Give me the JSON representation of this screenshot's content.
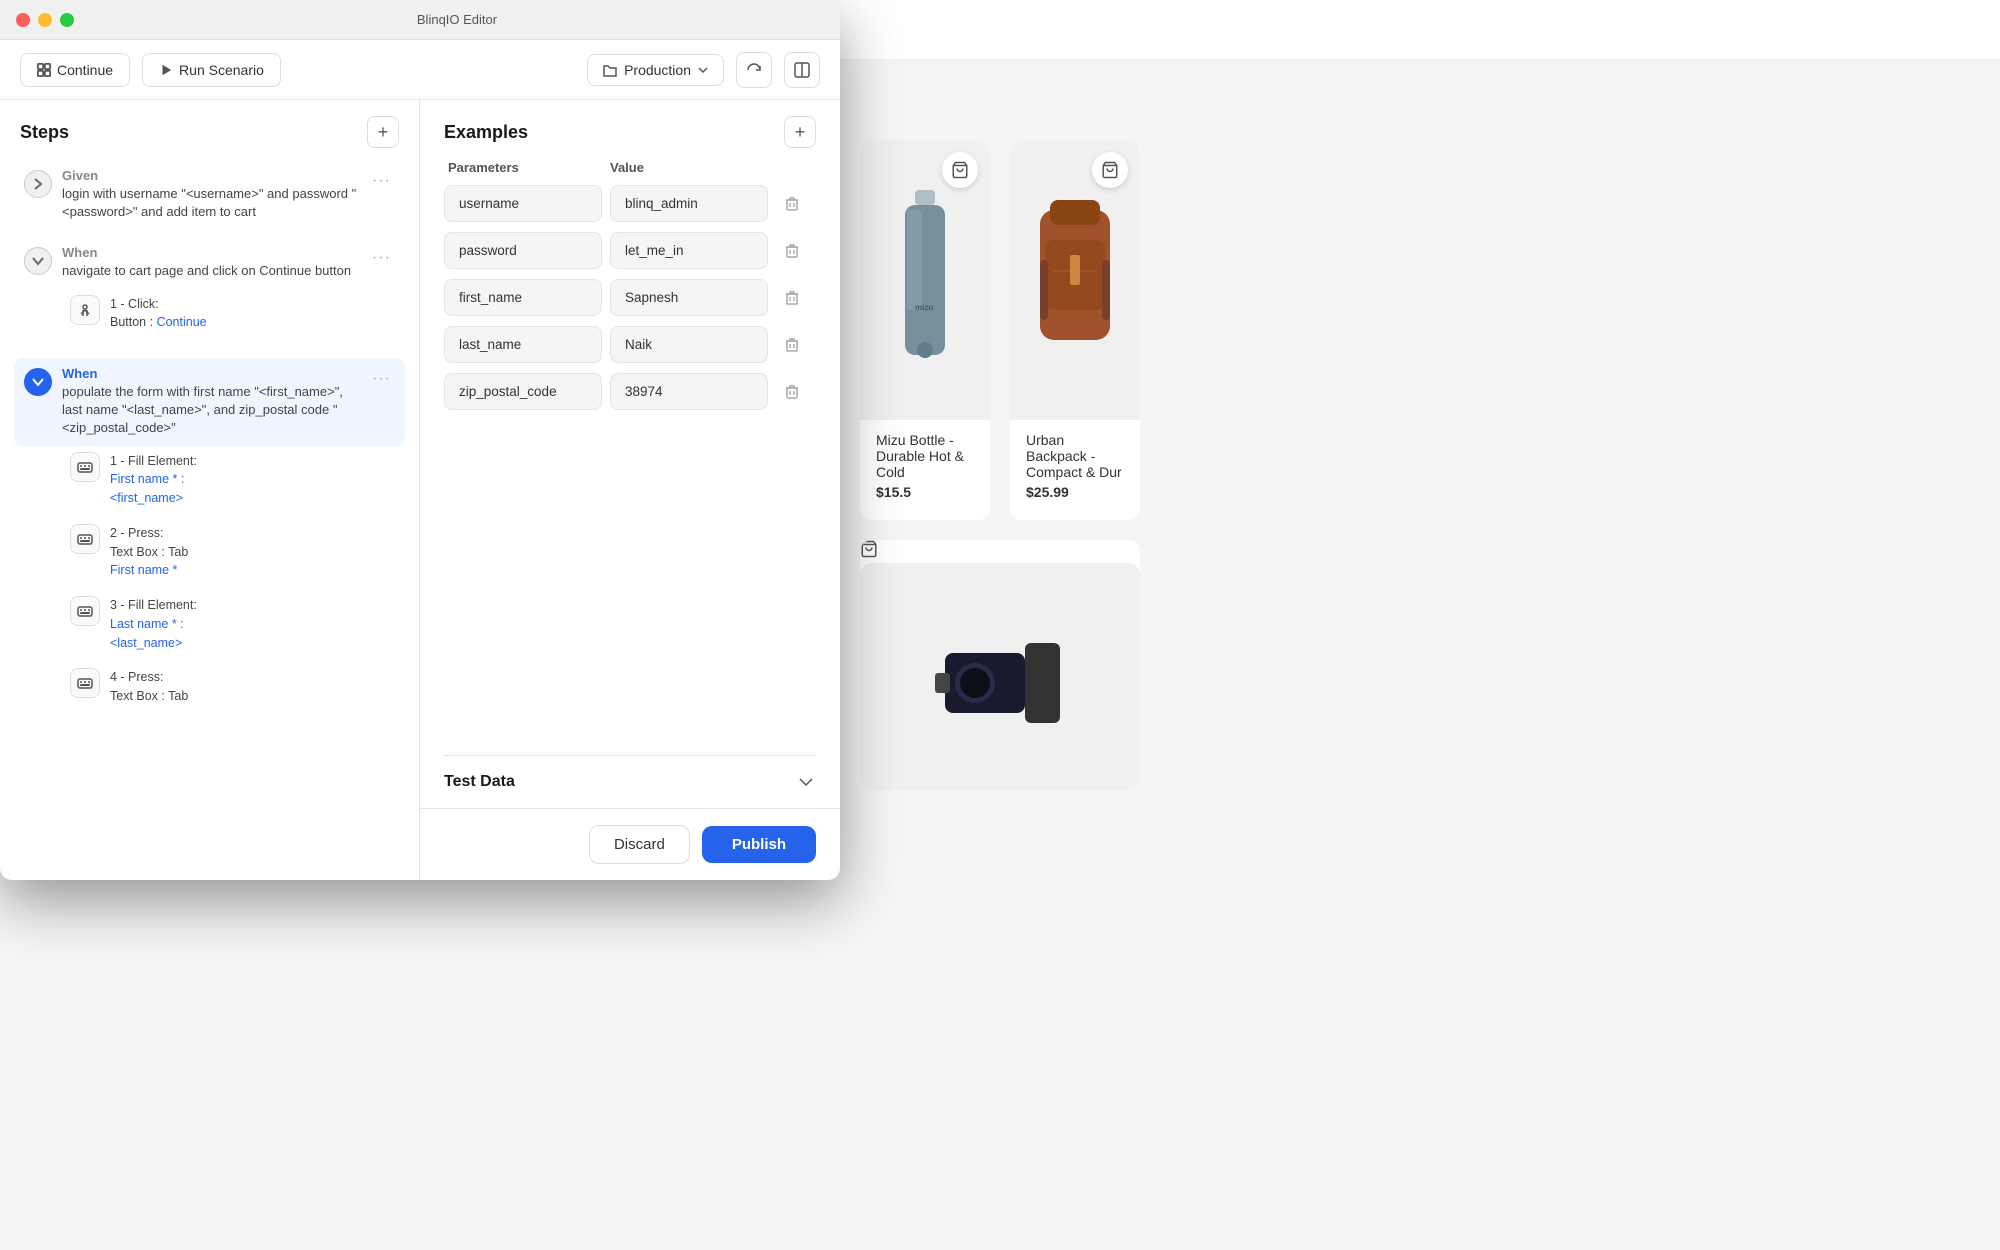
{
  "app": {
    "title": "BlinqIO Editor",
    "window_controls": {
      "red": "close",
      "yellow": "minimize",
      "green": "maximize"
    }
  },
  "toolbar": {
    "continue_label": "Continue",
    "run_scenario_label": "Run Scenario",
    "environment": "Production",
    "env_icon": "folder-icon",
    "refresh_icon": "refresh-icon",
    "layout_icon": "layout-icon"
  },
  "steps": {
    "title": "Steps",
    "add_button_label": "+",
    "items": [
      {
        "type": "Given",
        "description": "login with username \"<username>\" and password \"<password>\" and add item to cart",
        "expanded": false
      },
      {
        "type": "When",
        "description": "navigate to cart page and click on Continue button",
        "expanded": true,
        "sub_steps": [
          {
            "number": "1",
            "action": "Click:",
            "target": "Button : Continue",
            "target_link": "Continue"
          }
        ]
      },
      {
        "type": "When",
        "description": "populate the form with first name \"<first_name>\", last name \"<last_name>\", and zip_postal code \"<zip_postal_code>\"",
        "expanded": true,
        "active": true,
        "sub_steps": [
          {
            "number": "1",
            "action": "Fill Element:",
            "target": "First name * :",
            "target_link": "First name *",
            "variable": "<first_name>"
          },
          {
            "number": "2",
            "action": "Press:",
            "target": "Text Box : Tab",
            "target_link": "First name *"
          },
          {
            "number": "3",
            "action": "Fill Element:",
            "target": "Last name * :",
            "target_link": "Last name *",
            "variable": "<last_name>"
          },
          {
            "number": "4",
            "action": "Press:",
            "target": "Text Box : Tab"
          }
        ]
      }
    ]
  },
  "examples": {
    "title": "Examples",
    "add_button_label": "+",
    "columns": {
      "parameters": "Parameters",
      "value": "Value"
    },
    "rows": [
      {
        "param": "username",
        "value": "blinq_admin"
      },
      {
        "param": "password",
        "value": "let_me_in"
      },
      {
        "param": "first_name",
        "value": "Sapnesh"
      },
      {
        "param": "last_name",
        "value": "Naik"
      },
      {
        "param": "zip_postal_code",
        "value": "38974"
      }
    ]
  },
  "test_data": {
    "title": "Test Data"
  },
  "footer": {
    "discard_label": "Discard",
    "publish_label": "Publish"
  },
  "bg_products": [
    {
      "name": "Mizu Bottle - Durable Hot & Cold",
      "price": "$15.5"
    },
    {
      "name": "Urban Backpack - Compact & Dur",
      "price": "$25.99"
    }
  ]
}
